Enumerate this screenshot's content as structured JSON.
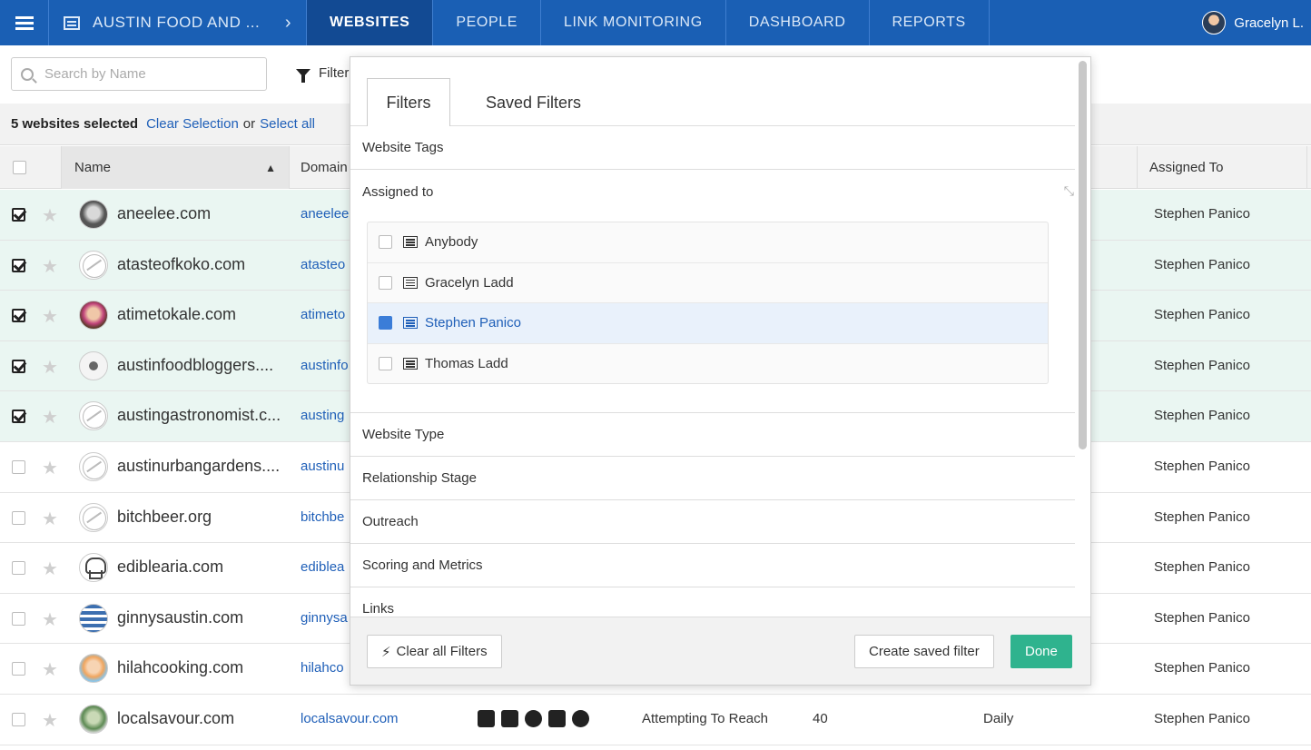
{
  "nav": {
    "project": "AUSTIN FOOD AND ...",
    "tabs": [
      "WEBSITES",
      "PEOPLE",
      "LINK MONITORING",
      "DASHBOARD",
      "REPORTS"
    ],
    "user": "Gracelyn L."
  },
  "toolbar": {
    "search_placeholder": "Search by Name",
    "filter_label": "Filter"
  },
  "selection": {
    "count_text": "5 websites selected",
    "clear_label": "Clear Selection",
    "or_text": "or",
    "select_all_label": "Select all"
  },
  "table": {
    "headers": {
      "name": "Name",
      "domain": "Domain",
      "assigned": "Assigned To"
    },
    "rows": [
      {
        "name": "aneelee.com",
        "domain": "aneelee",
        "assigned": "Stephen Panico"
      },
      {
        "name": "atasteofkoko.com",
        "domain": "atasteo",
        "assigned": "Stephen Panico"
      },
      {
        "name": "atimetokale.com",
        "domain": "atimeto",
        "assigned": "Stephen Panico"
      },
      {
        "name": "austinfoodbloggers....",
        "domain": "austinfo",
        "assigned": "Stephen Panico"
      },
      {
        "name": "austingastronomist.c...",
        "domain": "austing",
        "assigned": "Stephen Panico"
      },
      {
        "name": "austinurbangardens....",
        "domain": "austinu",
        "assigned": "Stephen Panico"
      },
      {
        "name": "bitchbeer.org",
        "domain": "bitchbe",
        "assigned": "Stephen Panico"
      },
      {
        "name": "ediblearia.com",
        "domain": "ediblea",
        "assigned": "Stephen Panico"
      },
      {
        "name": "ginnysaustin.com",
        "domain": "ginnysa",
        "assigned": "Stephen Panico"
      },
      {
        "name": "hilahcooking.com",
        "domain": "hilahco",
        "assigned": "Stephen Panico"
      },
      {
        "name": "localsavour.com",
        "domain": "localsavour.com",
        "stage": "Attempting To Reach",
        "score": "40",
        "frequency": "Daily",
        "assigned": "Stephen Panico"
      }
    ]
  },
  "panel": {
    "tabs": {
      "filters": "Filters",
      "saved": "Saved Filters"
    },
    "sections": {
      "tags": "Website Tags",
      "assigned": "Assigned to",
      "type": "Website Type",
      "stage": "Relationship Stage",
      "outreach": "Outreach",
      "scoring": "Scoring and Metrics",
      "links": "Links"
    },
    "assignees": [
      "Anybody",
      "Gracelyn Ladd",
      "Stephen Panico",
      "Thomas Ladd"
    ],
    "buttons": {
      "clear": "Clear all Filters",
      "save": "Create saved filter",
      "done": "Done"
    }
  },
  "colors": {
    "nav": "#1a5fb4",
    "link": "#1f5fb8",
    "done": "#2fb38e",
    "selected_row": "#eaf6f2"
  }
}
